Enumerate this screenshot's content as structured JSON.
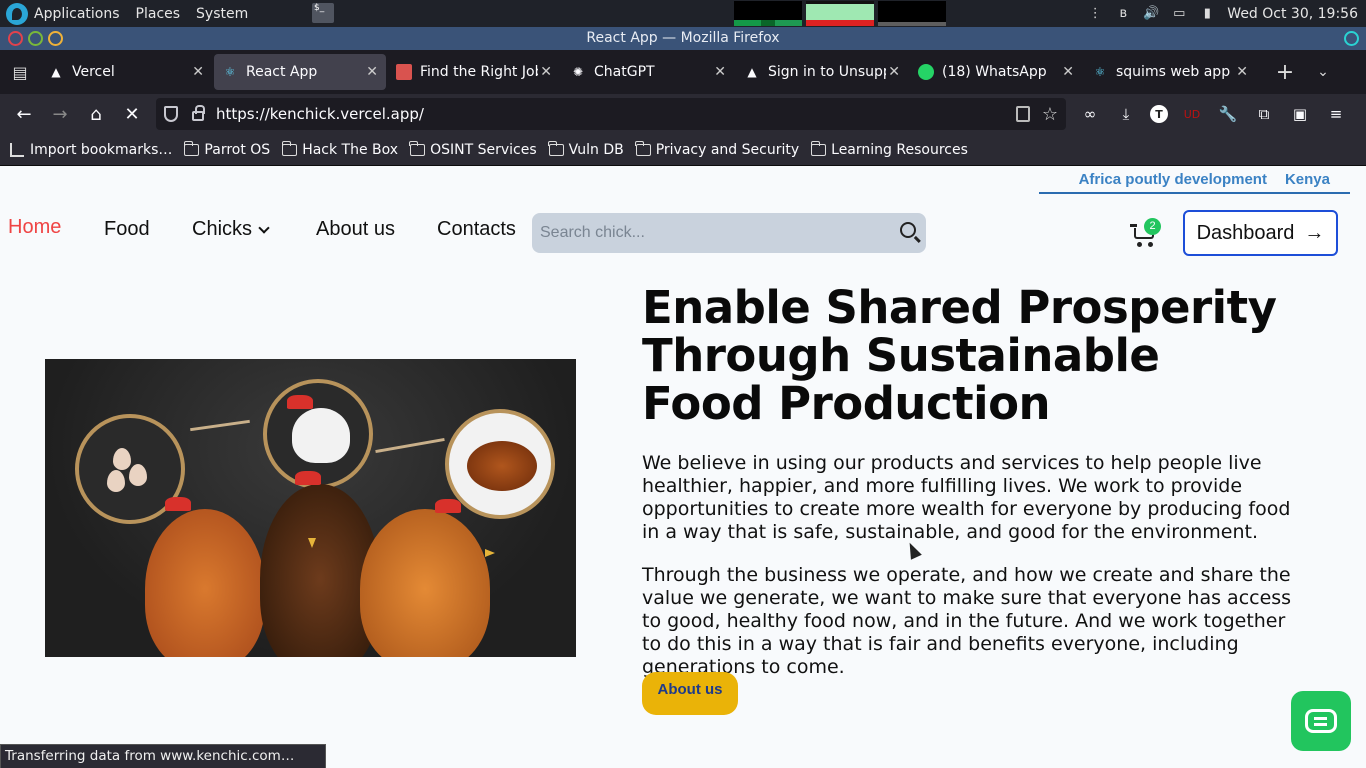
{
  "system": {
    "menus": [
      "Applications",
      "Places",
      "System"
    ],
    "clock": "Wed Oct 30, 19:56"
  },
  "window": {
    "title": "React App — Mozilla Firefox"
  },
  "tabs": [
    {
      "label": "Vercel",
      "icon": "vercel-icon"
    },
    {
      "label": "React App",
      "icon": "react-icon",
      "active": true
    },
    {
      "label": "Find the Right Job",
      "icon": "job-site-icon"
    },
    {
      "label": "ChatGPT",
      "icon": "chatgpt-icon"
    },
    {
      "label": "Sign in to Unsupp",
      "icon": "vercel-icon"
    },
    {
      "label": "(18) WhatsApp",
      "icon": "whatsapp-icon"
    },
    {
      "label": "squims web app",
      "icon": "react-icon"
    }
  ],
  "urlbar": {
    "url": "https://kenchick.vercel.app/"
  },
  "bookmarks": [
    {
      "label": "Import bookmarks…",
      "type": "import"
    },
    {
      "label": "Parrot OS",
      "type": "folder"
    },
    {
      "label": "Hack The Box",
      "type": "folder"
    },
    {
      "label": "OSINT Services",
      "type": "folder"
    },
    {
      "label": "Vuln DB",
      "type": "folder"
    },
    {
      "label": "Privacy and Security",
      "type": "folder"
    },
    {
      "label": "Learning Resources",
      "type": "folder"
    }
  ],
  "site": {
    "top_links": [
      "Africa poutly development",
      "Kenya"
    ],
    "nav": {
      "home": "Home",
      "food": "Food",
      "chicks": "Chicks",
      "about": "About us",
      "contacts": "Contacts"
    },
    "search_placeholder": "Search chick...",
    "cart_count": "2",
    "dashboard_label": "Dashboard",
    "hero": {
      "title": "Enable Shared Prosperity Through Sustainable Food Production",
      "p1": "We believe in using our products and services to help people live healthier, happier, and more fulfilling lives. We work to provide opportunities to create more wealth for everyone by producing food in a way that is safe, sustainable, and good for the environment.",
      "p2": "Through the business we operate, and how we create and share the value we generate, we want to make sure that everyone has access to good, healthy food now, and in the future. And we work together to do this in a way that is fair and benefits everyone, including generations to come.",
      "cta": "About us"
    }
  },
  "status": {
    "text": "Transferring data from www.kenchic.com…"
  },
  "colors": {
    "accent_blue": "#1d4ed8",
    "home_red": "#ef4444",
    "cta_yellow": "#eab308",
    "chat_green": "#22c55e"
  }
}
